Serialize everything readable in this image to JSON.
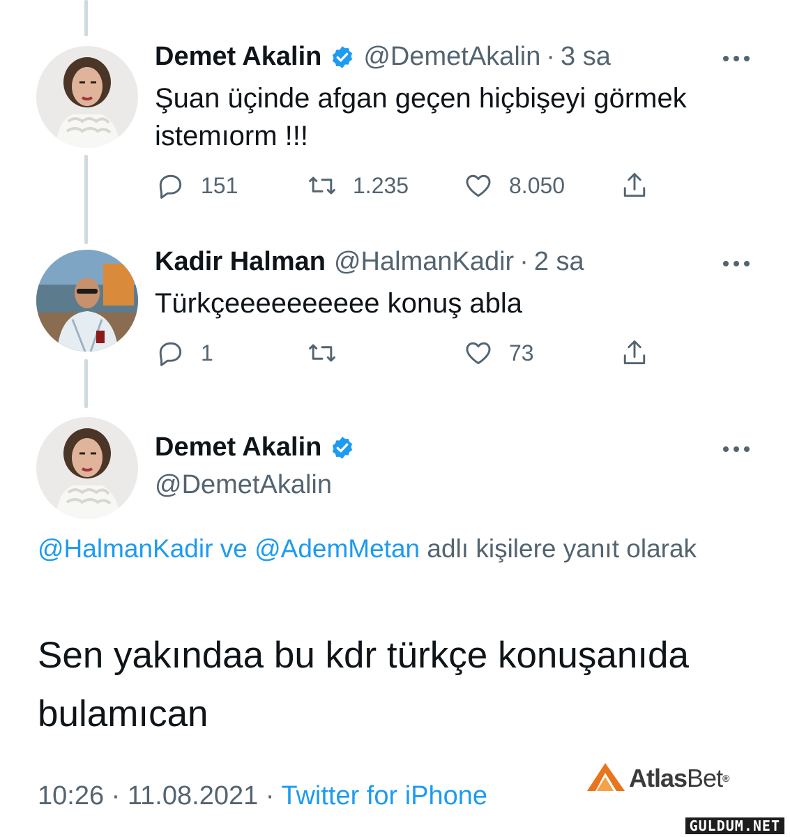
{
  "tweets": [
    {
      "name": "Demet Akalin",
      "verified": true,
      "handle": "@DemetAkalin",
      "time": "3 sa",
      "text": "Şuan üçinde afgan geçen hiçbişeyi görmek istemıorm !!!",
      "replies": "151",
      "retweets": "1.235",
      "likes": "8.050"
    },
    {
      "name": "Kadir Halman",
      "verified": false,
      "handle": "@HalmanKadir",
      "time": "2 sa",
      "text": "Türkçeeeeeeeeee konuş abla",
      "replies": "1",
      "retweets": "",
      "likes": "73"
    }
  ],
  "main_tweet": {
    "name": "Demet Akalin",
    "handle": "@DemetAkalin",
    "reply_to_1": "@HalmanKadir",
    "reply_and": "ve",
    "reply_to_2": "@AdemMetan",
    "reply_suffix": "adlı kişilere yanıt olarak",
    "text": "Sen yakındaa bu kdr türkçe konuşanıda bulamıcan",
    "timestamp": "10:26 · 11.08.2021 ·",
    "source": "Twitter for iPhone"
  },
  "overlay": {
    "brand_bold": "Atlas",
    "brand_thin": "Bet",
    "brand_mark": "®",
    "watermark": "GULDUM.NET"
  },
  "colors": {
    "accent": "#1d9bf0",
    "muted": "#536471",
    "line": "#cfd9de",
    "logo": "#e8741c"
  }
}
